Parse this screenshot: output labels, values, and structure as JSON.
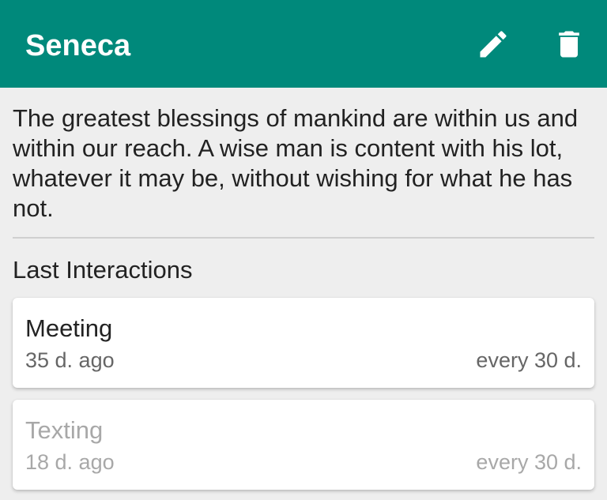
{
  "appbar": {
    "title": "Seneca",
    "background_color": "#00897b",
    "actions": [
      {
        "icon": "pencil-icon",
        "label": "Edit"
      },
      {
        "icon": "trash-icon",
        "label": "Delete"
      }
    ]
  },
  "quote": {
    "text": "The greatest blessings of mankind are within us and within our reach. A wise man is content with his lot, whatever it may be, without wishing for what he has not."
  },
  "interactions": {
    "heading": "Last Interactions",
    "items": [
      {
        "type": "Meeting",
        "last": "35 d. ago",
        "frequency": "every 30 d.",
        "state": "active"
      },
      {
        "type": "Texting",
        "last": "18 d. ago",
        "frequency": "every 30 d.",
        "state": "inactive"
      }
    ]
  }
}
